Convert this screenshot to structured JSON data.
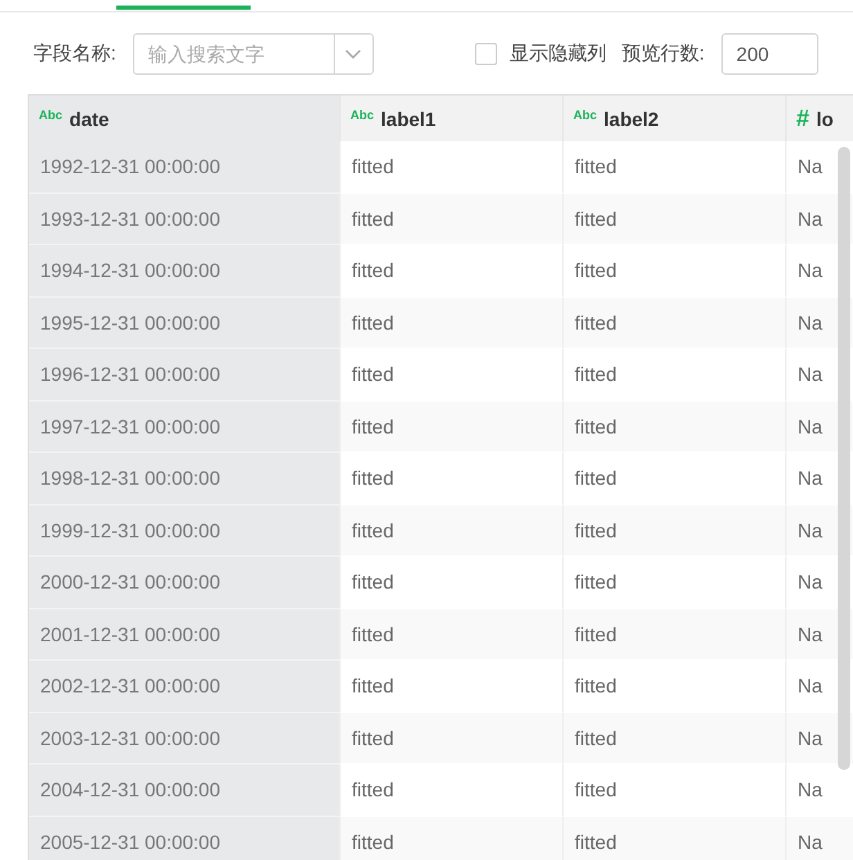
{
  "toolbar": {
    "field_label": "字段名称:",
    "search": {
      "placeholder": "输入搜索文字"
    },
    "show_hidden": {
      "label": "显示隐藏列",
      "checked": false
    },
    "preview_label": "预览行数:",
    "preview_value": "200"
  },
  "table": {
    "columns": [
      {
        "name": "date",
        "kind": "text",
        "type_icon": "Abc"
      },
      {
        "name": "label1",
        "kind": "text",
        "type_icon": "Abc"
      },
      {
        "name": "label2",
        "kind": "text",
        "type_icon": "Abc"
      },
      {
        "name": "lo",
        "kind": "number",
        "type_icon": "#"
      }
    ],
    "rows": [
      [
        "1992-12-31 00:00:00",
        "fitted",
        "fitted",
        "Na"
      ],
      [
        "1993-12-31 00:00:00",
        "fitted",
        "fitted",
        "Na"
      ],
      [
        "1994-12-31 00:00:00",
        "fitted",
        "fitted",
        "Na"
      ],
      [
        "1995-12-31 00:00:00",
        "fitted",
        "fitted",
        "Na"
      ],
      [
        "1996-12-31 00:00:00",
        "fitted",
        "fitted",
        "Na"
      ],
      [
        "1997-12-31 00:00:00",
        "fitted",
        "fitted",
        "Na"
      ],
      [
        "1998-12-31 00:00:00",
        "fitted",
        "fitted",
        "Na"
      ],
      [
        "1999-12-31 00:00:00",
        "fitted",
        "fitted",
        "Na"
      ],
      [
        "2000-12-31 00:00:00",
        "fitted",
        "fitted",
        "Na"
      ],
      [
        "2001-12-31 00:00:00",
        "fitted",
        "fitted",
        "Na"
      ],
      [
        "2002-12-31 00:00:00",
        "fitted",
        "fitted",
        "Na"
      ],
      [
        "2003-12-31 00:00:00",
        "fitted",
        "fitted",
        "Na"
      ],
      [
        "2004-12-31 00:00:00",
        "fitted",
        "fitted",
        "Na"
      ],
      [
        "2005-12-31 00:00:00",
        "fitted",
        "fitted",
        "Na"
      ]
    ]
  }
}
